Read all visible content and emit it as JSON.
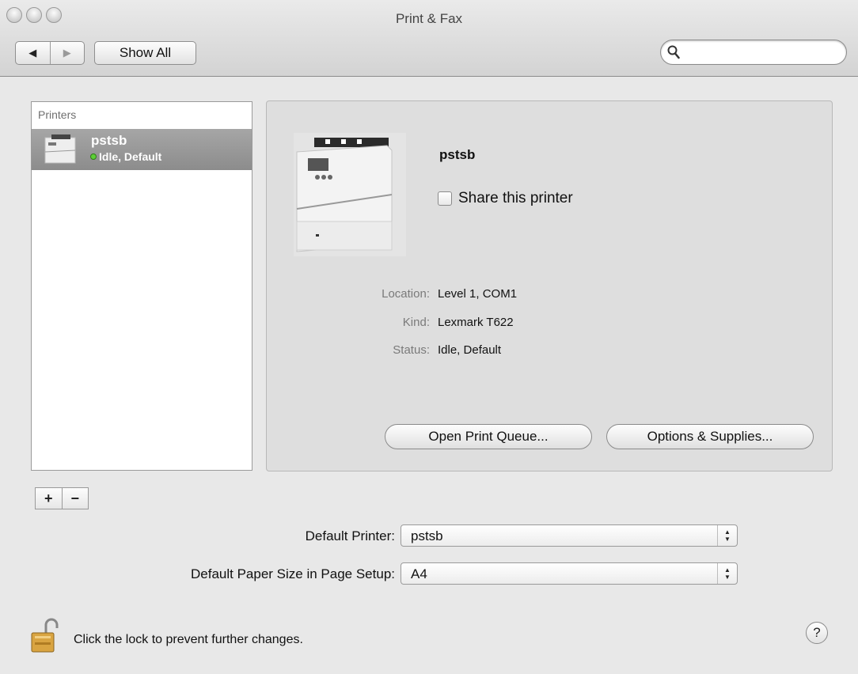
{
  "window": {
    "title": "Print & Fax"
  },
  "toolbar": {
    "back_glyph": "◀",
    "forward_glyph": "▶",
    "show_all_label": "Show All",
    "search_placeholder": ""
  },
  "printers": {
    "header": "Printers",
    "items": [
      {
        "name": "pstsb",
        "status": "Idle, Default",
        "status_color": "#5dcf36",
        "selected": true
      }
    ],
    "add_label": "+",
    "remove_label": "−"
  },
  "details": {
    "name": "pstsb",
    "share_label": "Share this printer",
    "share_checked": false,
    "location_label": "Location:",
    "location_value": "Level 1, COM1",
    "kind_label": "Kind:",
    "kind_value": "Lexmark T622",
    "status_label": "Status:",
    "status_value": "Idle, Default",
    "open_queue_label": "Open Print Queue...",
    "options_label": "Options & Supplies..."
  },
  "defaults": {
    "printer_label": "Default Printer:",
    "printer_value": "pstsb",
    "paper_label": "Default Paper Size in Page Setup:",
    "paper_value": "A4"
  },
  "footer": {
    "lock_message": "Click the lock to prevent further changes.",
    "help_label": "?"
  },
  "colors": {
    "selection": "#999999",
    "lock_gold": "#d9a441"
  }
}
